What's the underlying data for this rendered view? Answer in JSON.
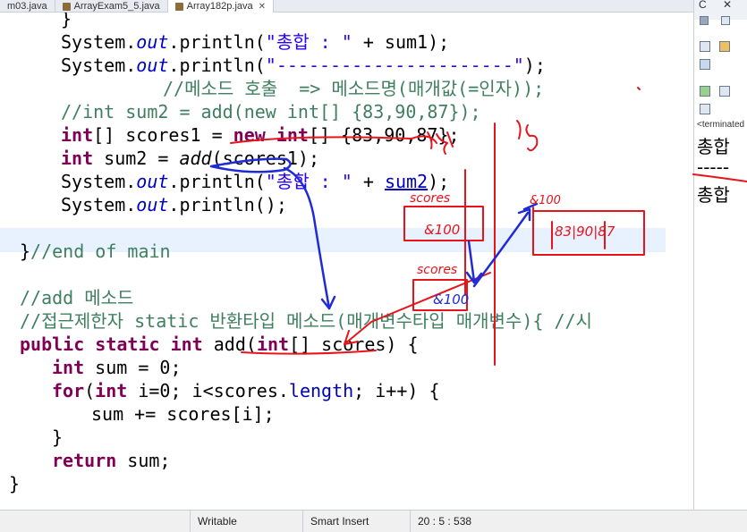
{
  "tabs": [
    {
      "label": "m03.java"
    },
    {
      "label": "ArrayExam5_5.java"
    },
    {
      "label": "Array182p.java",
      "close": "✕"
    }
  ],
  "code": {
    "l1": "}",
    "l2a": "System.",
    "l2b": "out",
    "l2c": ".println(",
    "l2d": "\"총합 : \"",
    "l2e": " + sum1);",
    "l3a": "System.",
    "l3b": "out",
    "l3c": ".println(",
    "l3d": "\"----------------------\"",
    "l3e": ");",
    "l4": "//메소드 호출  => 메소드명(매개값(=인자));",
    "l5": "//int sum2 = add(new int[] {83,90,87});",
    "l6a": "int",
    "l6b": "[] scores1 = ",
    "l6c": "new",
    "l6d": " ",
    "l6e": "int",
    "l6f": "[] {83,90,87};",
    "l7a": "int",
    "l7b": " sum2 = ",
    "l7c": "add",
    "l7d": "(scores1);",
    "l8a": "System.",
    "l8b": "out",
    "l8c": ".println(",
    "l8d": "\"총합 : \"",
    "l8e": " + ",
    "l8f": "sum2",
    "l8g": ");",
    "l9a": "System.",
    "l9b": "out",
    "l9c": ".println();",
    "l10a": "}",
    "l10b": "//end of main",
    "l11": "//add 메소드",
    "l12": "//접근제한자 static 반환타입 메소드(매개변수타입 매개변수){ //시",
    "l13a": "public",
    "l13b": " ",
    "l13c": "static",
    "l13d": " ",
    "l13e": "int",
    "l13f": " add(",
    "l13g": "int",
    "l13h": "[] scores) {",
    "l14a": "int",
    "l14b": " sum = 0;",
    "l15a": "for",
    "l15b": "(",
    "l15c": "int",
    "l15d": " i=0; i<scores.",
    "l15e": "length",
    "l15f": "; i++) {",
    "l16": "sum += scores[i];",
    "l17": "}",
    "l18a": "return",
    "l18b": " sum;",
    "l19": "}"
  },
  "right_panel": {
    "terminated": "<terminated",
    "console_line1": "총합",
    "console_line2": "-----",
    "console_line3": "총합"
  },
  "annotations": {
    "scores": "scores",
    "scores2": "scores",
    "addr": "&100",
    "addr2": "&100",
    "addr3": "&100",
    "values": "83|90|87"
  },
  "status": {
    "mode": "Writable",
    "insert": "Smart Insert",
    "position": "20 : 5 : 538"
  },
  "colors": {
    "ink_red": "#e8141c",
    "ink_blue": "#1f2bd6"
  }
}
